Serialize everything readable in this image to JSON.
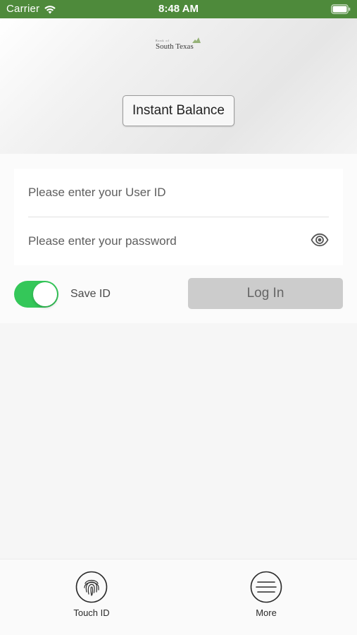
{
  "status_bar": {
    "carrier": "Carrier",
    "time": "8:48 AM",
    "wifi_icon": "wifi-icon",
    "battery_icon": "battery-icon",
    "color": "#4e8a3b"
  },
  "header": {
    "logo": {
      "small_text": "Bank of",
      "main_text": "South Texas"
    },
    "instant_balance_label": "Instant Balance"
  },
  "login": {
    "user_id_placeholder": "Please enter your User ID",
    "password_placeholder": "Please enter your password",
    "show_password_icon": "eye-icon",
    "save_id": {
      "label": "Save ID",
      "enabled": true,
      "color": "#34c759"
    },
    "login_label": "Log In"
  },
  "tab_bar": {
    "items": [
      {
        "label": "Touch ID",
        "icon": "fingerprint-icon"
      },
      {
        "label": "More",
        "icon": "menu-icon"
      }
    ]
  }
}
